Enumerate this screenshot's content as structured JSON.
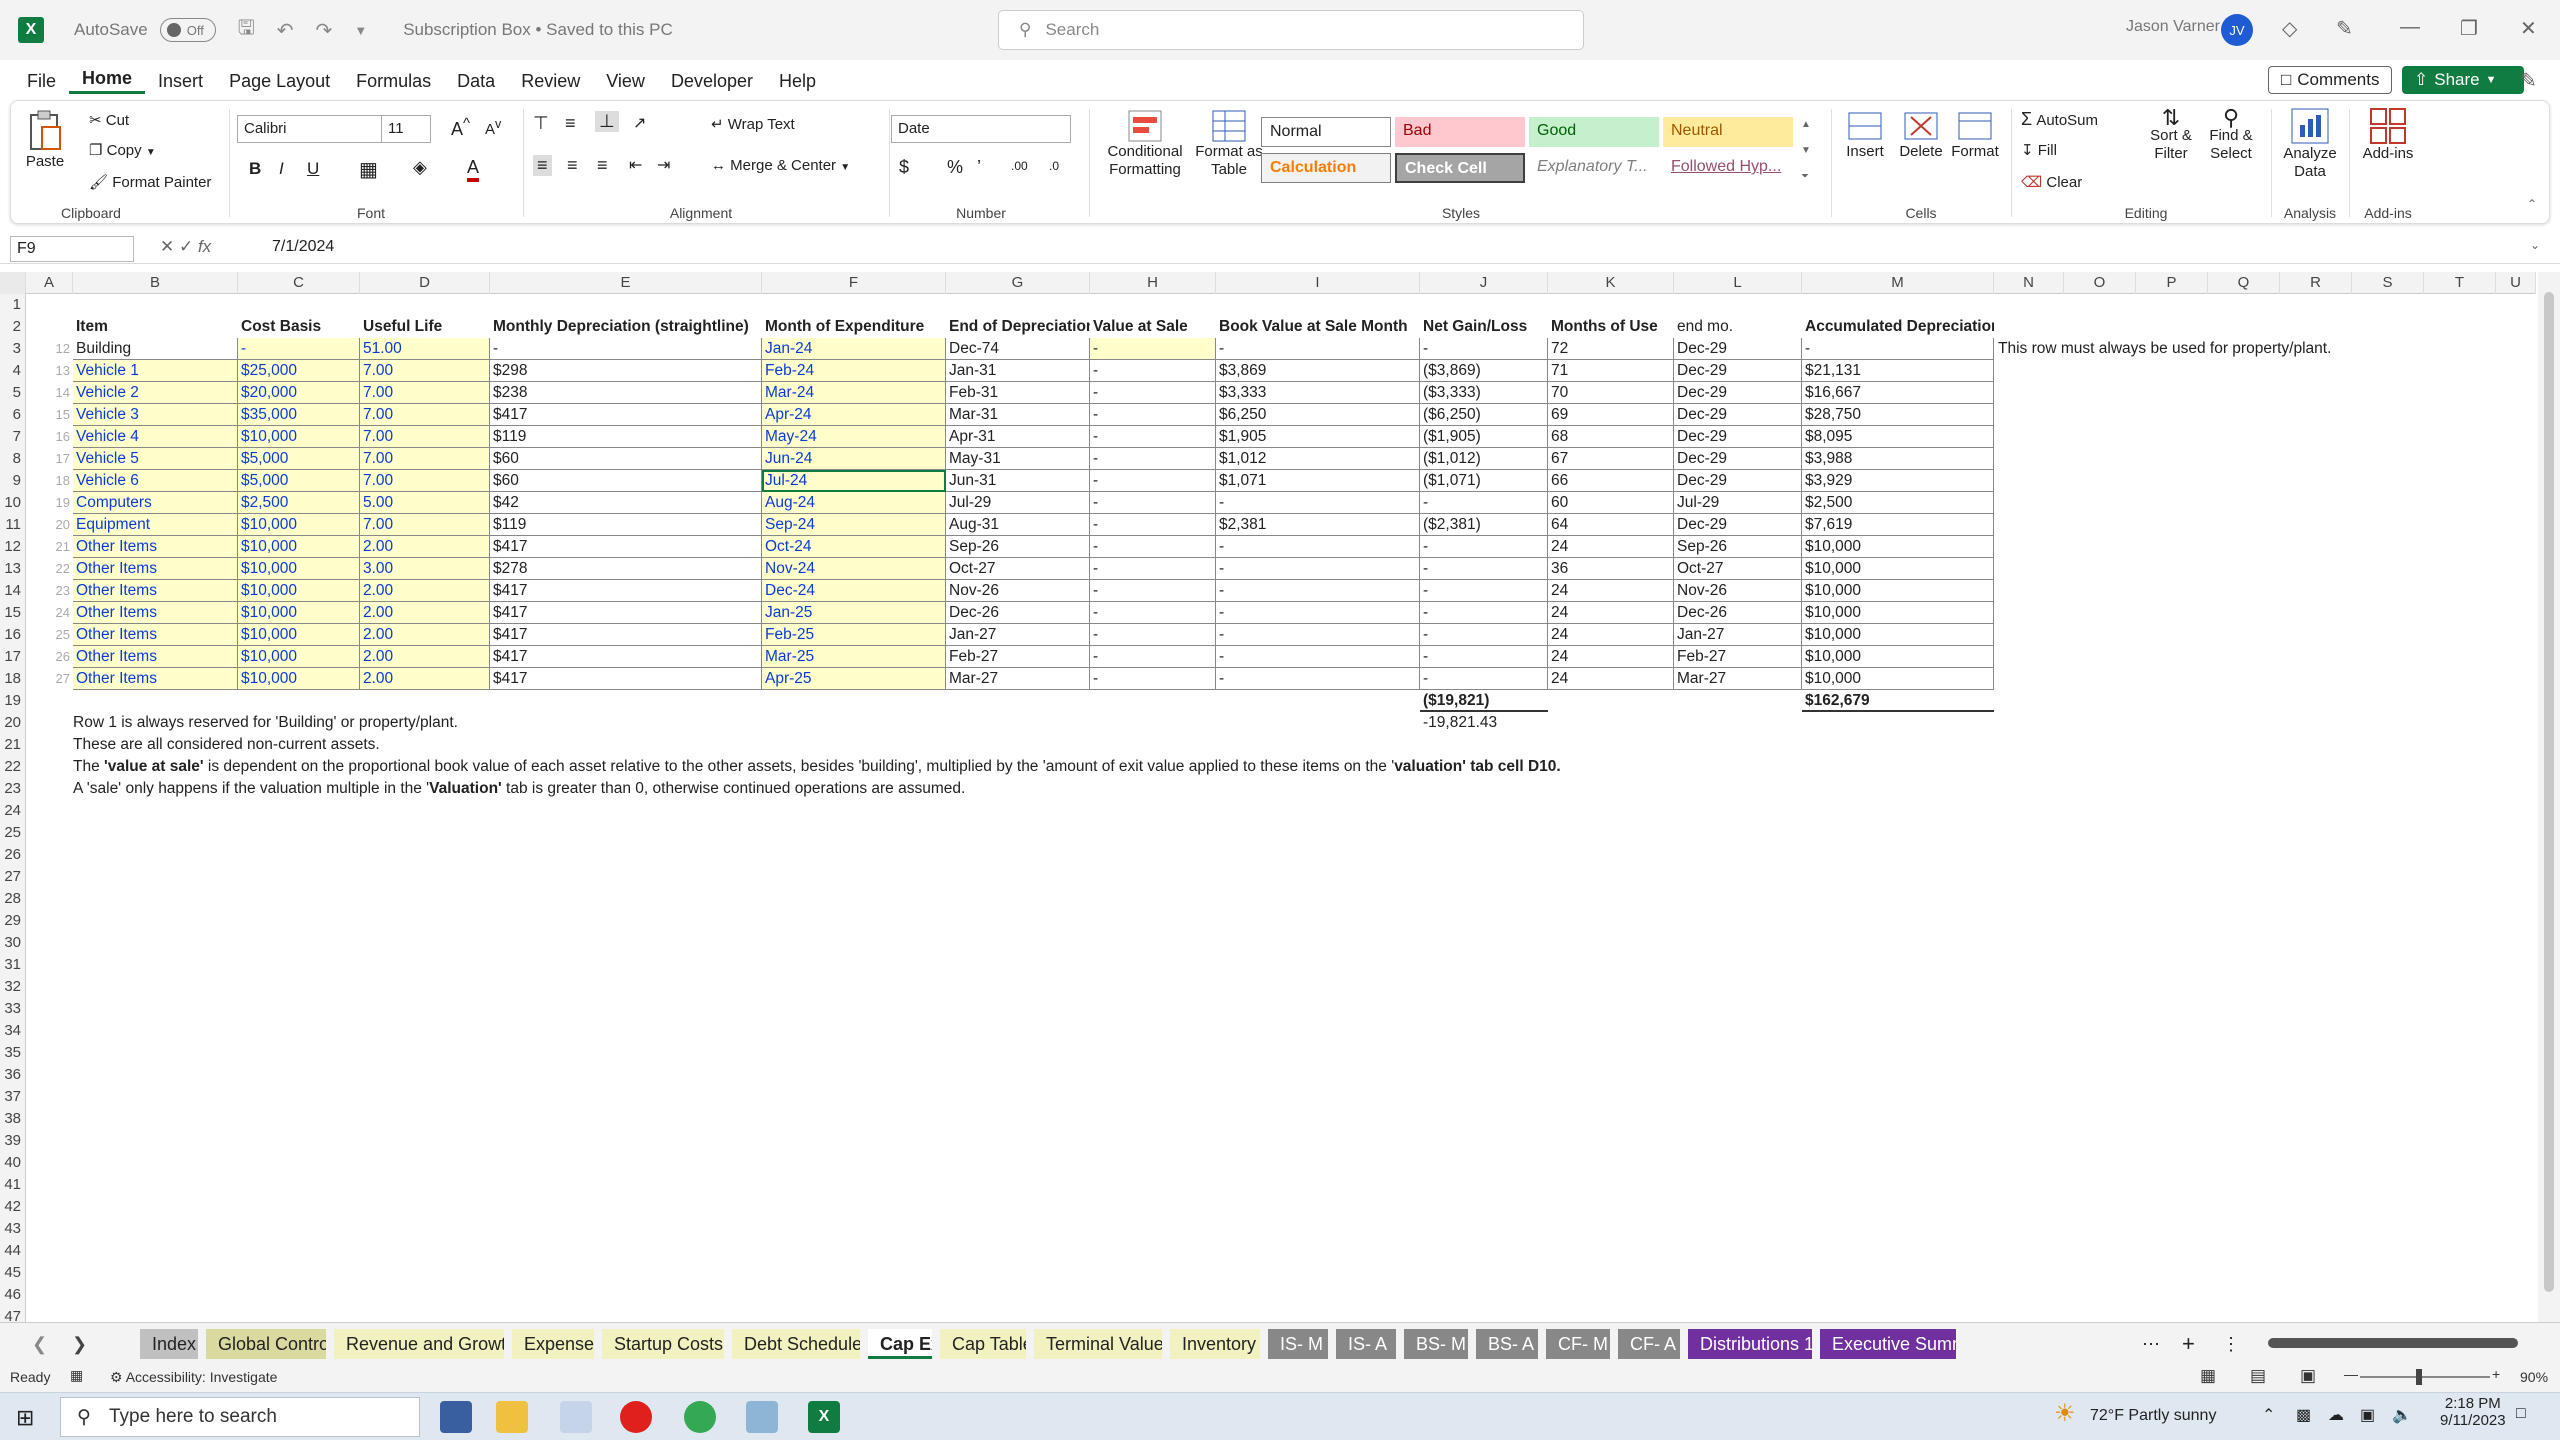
{
  "titlebar": {
    "autosave": "AutoSave",
    "toggle": "Off",
    "doc_title": "Subscription Box • Saved to this PC",
    "search": "Search",
    "user": "Jason Varner",
    "initials": "JV"
  },
  "menu": [
    "File",
    "Home",
    "Insert",
    "Page Layout",
    "Formulas",
    "Data",
    "Review",
    "View",
    "Developer",
    "Help"
  ],
  "menu_right": {
    "comments": "Comments",
    "share": "Share"
  },
  "ribbon": {
    "clipboard": {
      "paste": "Paste",
      "cut": "Cut",
      "copy": "Copy",
      "format_painter": "Format Painter",
      "label": "Clipboard"
    },
    "font": {
      "name": "Calibri",
      "size": "11",
      "label": "Font"
    },
    "alignment": {
      "wrap": "Wrap Text",
      "merge": "Merge & Center",
      "label": "Alignment"
    },
    "number": {
      "format": "Date",
      "label": "Number"
    },
    "styles": {
      "cond": "Conditional",
      "cond2": "Formatting",
      "fmt_table": "Format as",
      "fmt_table2": "Table",
      "normal": "Normal",
      "bad": "Bad",
      "good": "Good",
      "neutral": "Neutral",
      "calculation": "Calculation",
      "check": "Check Cell",
      "explanatory": "Explanatory T...",
      "followed": "Followed Hyp...",
      "label": "Styles"
    },
    "cells": {
      "insert": "Insert",
      "delete": "Delete",
      "format": "Format",
      "label": "Cells"
    },
    "editing": {
      "autosum": "AutoSum",
      "fill": "Fill",
      "clear": "Clear",
      "sort": "Sort &",
      "sort2": "Filter",
      "find": "Find &",
      "find2": "Select",
      "label": "Editing"
    },
    "analysis": {
      "analyze": "Analyze",
      "analyze2": "Data",
      "label": "Analysis"
    },
    "addins": {
      "addins": "Add-ins",
      "label": "Add-ins"
    }
  },
  "formula_bar": {
    "name_box": "F9",
    "formula": "7/1/2024"
  },
  "columns": [
    "A",
    "B",
    "C",
    "D",
    "E",
    "F",
    "G",
    "H",
    "I",
    "J",
    "K",
    "L",
    "M",
    "N",
    "O",
    "P",
    "Q",
    "R",
    "S",
    "T",
    "U"
  ],
  "headers": [
    "Item",
    "Cost Basis",
    "Useful Life",
    "Monthly Depreciation (straightline)",
    "Month of Expenditure",
    "End of Depreciation",
    "Value at Sale",
    "Book Value at Sale Month",
    "Net Gain/Loss",
    "Months of Use",
    "end mo.",
    "Accumulated Depreciation"
  ],
  "rows": [
    {
      "n": "12",
      "item": "Building",
      "cost": "-",
      "life": "51.00",
      "monthly": "-",
      "month": "Jan-24",
      "end": "Dec-74",
      "sale": "-",
      "book": "-",
      "gain": "-",
      "months": "72",
      "endmo": "Dec-29",
      "accum": "-"
    },
    {
      "n": "13",
      "item": "Vehicle 1",
      "cost": "$25,000",
      "life": "7.00",
      "monthly": "$298",
      "month": "Feb-24",
      "end": "Jan-31",
      "sale": "-",
      "book": "$3,869",
      "gain": "($3,869)",
      "months": "71",
      "endmo": "Dec-29",
      "accum": "$21,131"
    },
    {
      "n": "14",
      "item": "Vehicle 2",
      "cost": "$20,000",
      "life": "7.00",
      "monthly": "$238",
      "month": "Mar-24",
      "end": "Feb-31",
      "sale": "-",
      "book": "$3,333",
      "gain": "($3,333)",
      "months": "70",
      "endmo": "Dec-29",
      "accum": "$16,667"
    },
    {
      "n": "15",
      "item": "Vehicle 3",
      "cost": "$35,000",
      "life": "7.00",
      "monthly": "$417",
      "month": "Apr-24",
      "end": "Mar-31",
      "sale": "-",
      "book": "$6,250",
      "gain": "($6,250)",
      "months": "69",
      "endmo": "Dec-29",
      "accum": "$28,750"
    },
    {
      "n": "16",
      "item": "Vehicle 4",
      "cost": "$10,000",
      "life": "7.00",
      "monthly": "$119",
      "month": "May-24",
      "end": "Apr-31",
      "sale": "-",
      "book": "$1,905",
      "gain": "($1,905)",
      "months": "68",
      "endmo": "Dec-29",
      "accum": "$8,095"
    },
    {
      "n": "17",
      "item": "Vehicle 5",
      "cost": "$5,000",
      "life": "7.00",
      "monthly": "$60",
      "month": "Jun-24",
      "end": "May-31",
      "sale": "-",
      "book": "$1,012",
      "gain": "($1,012)",
      "months": "67",
      "endmo": "Dec-29",
      "accum": "$3,988"
    },
    {
      "n": "18",
      "item": "Vehicle 6",
      "cost": "$5,000",
      "life": "7.00",
      "monthly": "$60",
      "month": "Jul-24",
      "end": "Jun-31",
      "sale": "-",
      "book": "$1,071",
      "gain": "($1,071)",
      "months": "66",
      "endmo": "Dec-29",
      "accum": "$3,929"
    },
    {
      "n": "19",
      "item": "Computers",
      "cost": "$2,500",
      "life": "5.00",
      "monthly": "$42",
      "month": "Aug-24",
      "end": "Jul-29",
      "sale": "-",
      "book": "-",
      "gain": "-",
      "months": "60",
      "endmo": "Jul-29",
      "accum": "$2,500"
    },
    {
      "n": "20",
      "item": "Equipment",
      "cost": "$10,000",
      "life": "7.00",
      "monthly": "$119",
      "month": "Sep-24",
      "end": "Aug-31",
      "sale": "-",
      "book": "$2,381",
      "gain": "($2,381)",
      "months": "64",
      "endmo": "Dec-29",
      "accum": "$7,619"
    },
    {
      "n": "21",
      "item": "Other Items",
      "cost": "$10,000",
      "life": "2.00",
      "monthly": "$417",
      "month": "Oct-24",
      "end": "Sep-26",
      "sale": "-",
      "book": "-",
      "gain": "-",
      "months": "24",
      "endmo": "Sep-26",
      "accum": "$10,000"
    },
    {
      "n": "22",
      "item": "Other Items",
      "cost": "$10,000",
      "life": "3.00",
      "monthly": "$278",
      "month": "Nov-24",
      "end": "Oct-27",
      "sale": "-",
      "book": "-",
      "gain": "-",
      "months": "36",
      "endmo": "Oct-27",
      "accum": "$10,000"
    },
    {
      "n": "23",
      "item": "Other Items",
      "cost": "$10,000",
      "life": "2.00",
      "monthly": "$417",
      "month": "Dec-24",
      "end": "Nov-26",
      "sale": "-",
      "book": "-",
      "gain": "-",
      "months": "24",
      "endmo": "Nov-26",
      "accum": "$10,000"
    },
    {
      "n": "24",
      "item": "Other Items",
      "cost": "$10,000",
      "life": "2.00",
      "monthly": "$417",
      "month": "Jan-25",
      "end": "Dec-26",
      "sale": "-",
      "book": "-",
      "gain": "-",
      "months": "24",
      "endmo": "Dec-26",
      "accum": "$10,000"
    },
    {
      "n": "25",
      "item": "Other Items",
      "cost": "$10,000",
      "life": "2.00",
      "monthly": "$417",
      "month": "Feb-25",
      "end": "Jan-27",
      "sale": "-",
      "book": "-",
      "gain": "-",
      "months": "24",
      "endmo": "Jan-27",
      "accum": "$10,000"
    },
    {
      "n": "26",
      "item": "Other Items",
      "cost": "$10,000",
      "life": "2.00",
      "monthly": "$417",
      "month": "Mar-25",
      "end": "Feb-27",
      "sale": "-",
      "book": "-",
      "gain": "-",
      "months": "24",
      "endmo": "Feb-27",
      "accum": "$10,000"
    },
    {
      "n": "27",
      "item": "Other Items",
      "cost": "$10,000",
      "life": "2.00",
      "monthly": "$417",
      "month": "Apr-25",
      "end": "Mar-27",
      "sale": "-",
      "book": "-",
      "gain": "-",
      "months": "24",
      "endmo": "Mar-27",
      "accum": "$10,000"
    }
  ],
  "side_note": "This row must always be used for property/plant.",
  "totals": {
    "gain": "($19,821)",
    "gain_raw": "-19,821.43",
    "accum": "$162,679"
  },
  "notes": {
    "n1": "Row 1 is always reserved for 'Building' or property/plant.",
    "n2": "These are all considered non-current assets.",
    "n3a": "The ",
    "n3b": "'value at sale'",
    "n3c": " is dependent on the proportional book value of each asset relative to the other assets, besides 'building', multiplied by the 'amount of exit value applied to these items on the '",
    "n3d": "valuation'",
    "n3e": " tab cell D10.",
    "n4a": "A 'sale' only happens if the valuation multiple in the '",
    "n4b": "Valuation'",
    "n4c": " tab is greater than 0, otherwise continued operations are assumed."
  },
  "sheet_tabs": [
    "Index",
    "Global Control",
    "Revenue and Growth",
    "Expenses",
    "Startup Costs",
    "Debt Schedule",
    "Cap Ex",
    "Cap Table",
    "Terminal Value",
    "Inventory",
    "IS- M",
    "IS- A",
    "BS- M",
    "BS- A",
    "CF- M",
    "CF- A",
    "Distributions 1",
    "Executive Summ"
  ],
  "status": {
    "ready": "Ready",
    "accessibility": "Accessibility: Investigate",
    "zoom": "90%"
  },
  "taskbar": {
    "search": "Type here to search",
    "weather": "72°F  Partly sunny",
    "time": "2:18 PM",
    "date": "9/11/2023"
  }
}
